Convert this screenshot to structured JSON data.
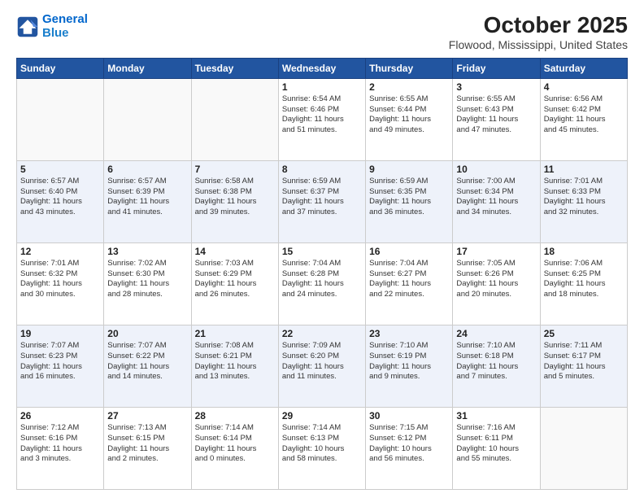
{
  "logo": {
    "line1": "General",
    "line2": "Blue"
  },
  "title": "October 2025",
  "subtitle": "Flowood, Mississippi, United States",
  "weekdays": [
    "Sunday",
    "Monday",
    "Tuesday",
    "Wednesday",
    "Thursday",
    "Friday",
    "Saturday"
  ],
  "weeks": [
    [
      {
        "day": "",
        "info": ""
      },
      {
        "day": "",
        "info": ""
      },
      {
        "day": "",
        "info": ""
      },
      {
        "day": "1",
        "info": "Sunrise: 6:54 AM\nSunset: 6:46 PM\nDaylight: 11 hours\nand 51 minutes."
      },
      {
        "day": "2",
        "info": "Sunrise: 6:55 AM\nSunset: 6:44 PM\nDaylight: 11 hours\nand 49 minutes."
      },
      {
        "day": "3",
        "info": "Sunrise: 6:55 AM\nSunset: 6:43 PM\nDaylight: 11 hours\nand 47 minutes."
      },
      {
        "day": "4",
        "info": "Sunrise: 6:56 AM\nSunset: 6:42 PM\nDaylight: 11 hours\nand 45 minutes."
      }
    ],
    [
      {
        "day": "5",
        "info": "Sunrise: 6:57 AM\nSunset: 6:40 PM\nDaylight: 11 hours\nand 43 minutes."
      },
      {
        "day": "6",
        "info": "Sunrise: 6:57 AM\nSunset: 6:39 PM\nDaylight: 11 hours\nand 41 minutes."
      },
      {
        "day": "7",
        "info": "Sunrise: 6:58 AM\nSunset: 6:38 PM\nDaylight: 11 hours\nand 39 minutes."
      },
      {
        "day": "8",
        "info": "Sunrise: 6:59 AM\nSunset: 6:37 PM\nDaylight: 11 hours\nand 37 minutes."
      },
      {
        "day": "9",
        "info": "Sunrise: 6:59 AM\nSunset: 6:35 PM\nDaylight: 11 hours\nand 36 minutes."
      },
      {
        "day": "10",
        "info": "Sunrise: 7:00 AM\nSunset: 6:34 PM\nDaylight: 11 hours\nand 34 minutes."
      },
      {
        "day": "11",
        "info": "Sunrise: 7:01 AM\nSunset: 6:33 PM\nDaylight: 11 hours\nand 32 minutes."
      }
    ],
    [
      {
        "day": "12",
        "info": "Sunrise: 7:01 AM\nSunset: 6:32 PM\nDaylight: 11 hours\nand 30 minutes."
      },
      {
        "day": "13",
        "info": "Sunrise: 7:02 AM\nSunset: 6:30 PM\nDaylight: 11 hours\nand 28 minutes."
      },
      {
        "day": "14",
        "info": "Sunrise: 7:03 AM\nSunset: 6:29 PM\nDaylight: 11 hours\nand 26 minutes."
      },
      {
        "day": "15",
        "info": "Sunrise: 7:04 AM\nSunset: 6:28 PM\nDaylight: 11 hours\nand 24 minutes."
      },
      {
        "day": "16",
        "info": "Sunrise: 7:04 AM\nSunset: 6:27 PM\nDaylight: 11 hours\nand 22 minutes."
      },
      {
        "day": "17",
        "info": "Sunrise: 7:05 AM\nSunset: 6:26 PM\nDaylight: 11 hours\nand 20 minutes."
      },
      {
        "day": "18",
        "info": "Sunrise: 7:06 AM\nSunset: 6:25 PM\nDaylight: 11 hours\nand 18 minutes."
      }
    ],
    [
      {
        "day": "19",
        "info": "Sunrise: 7:07 AM\nSunset: 6:23 PM\nDaylight: 11 hours\nand 16 minutes."
      },
      {
        "day": "20",
        "info": "Sunrise: 7:07 AM\nSunset: 6:22 PM\nDaylight: 11 hours\nand 14 minutes."
      },
      {
        "day": "21",
        "info": "Sunrise: 7:08 AM\nSunset: 6:21 PM\nDaylight: 11 hours\nand 13 minutes."
      },
      {
        "day": "22",
        "info": "Sunrise: 7:09 AM\nSunset: 6:20 PM\nDaylight: 11 hours\nand 11 minutes."
      },
      {
        "day": "23",
        "info": "Sunrise: 7:10 AM\nSunset: 6:19 PM\nDaylight: 11 hours\nand 9 minutes."
      },
      {
        "day": "24",
        "info": "Sunrise: 7:10 AM\nSunset: 6:18 PM\nDaylight: 11 hours\nand 7 minutes."
      },
      {
        "day": "25",
        "info": "Sunrise: 7:11 AM\nSunset: 6:17 PM\nDaylight: 11 hours\nand 5 minutes."
      }
    ],
    [
      {
        "day": "26",
        "info": "Sunrise: 7:12 AM\nSunset: 6:16 PM\nDaylight: 11 hours\nand 3 minutes."
      },
      {
        "day": "27",
        "info": "Sunrise: 7:13 AM\nSunset: 6:15 PM\nDaylight: 11 hours\nand 2 minutes."
      },
      {
        "day": "28",
        "info": "Sunrise: 7:14 AM\nSunset: 6:14 PM\nDaylight: 11 hours\nand 0 minutes."
      },
      {
        "day": "29",
        "info": "Sunrise: 7:14 AM\nSunset: 6:13 PM\nDaylight: 10 hours\nand 58 minutes."
      },
      {
        "day": "30",
        "info": "Sunrise: 7:15 AM\nSunset: 6:12 PM\nDaylight: 10 hours\nand 56 minutes."
      },
      {
        "day": "31",
        "info": "Sunrise: 7:16 AM\nSunset: 6:11 PM\nDaylight: 10 hours\nand 55 minutes."
      },
      {
        "day": "",
        "info": ""
      }
    ]
  ]
}
